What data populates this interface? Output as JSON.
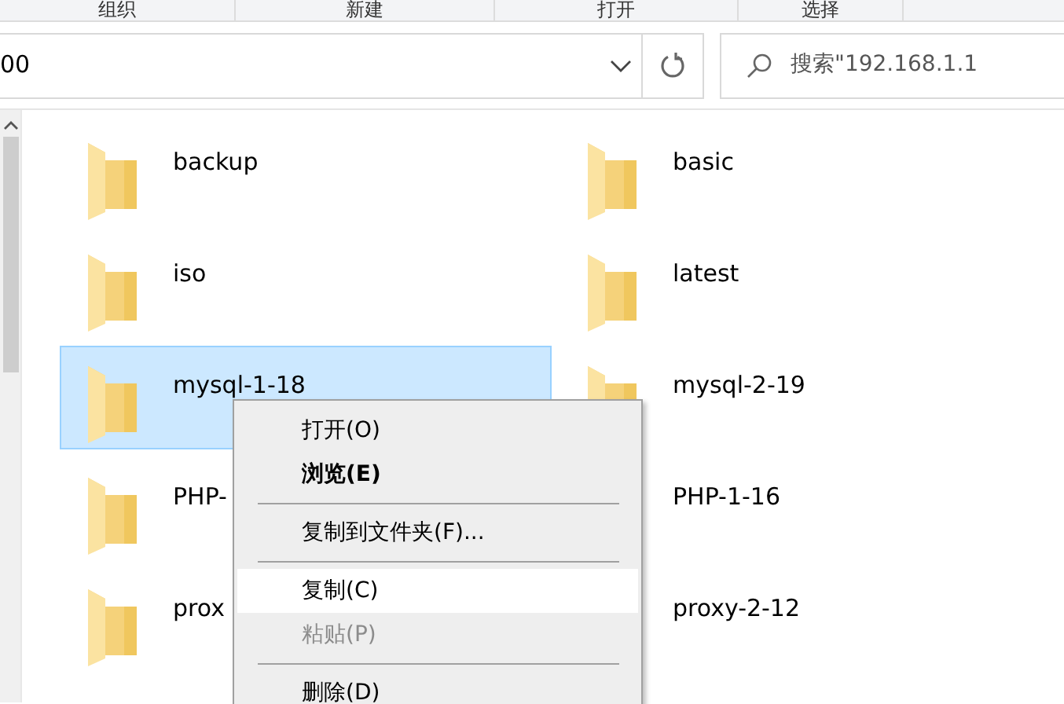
{
  "toolbar": {
    "groups": [
      "组织",
      "新建",
      "打开",
      "选择"
    ]
  },
  "address": {
    "value": "00"
  },
  "search": {
    "placeholder": "搜索\"192.168.1.1"
  },
  "folders": [
    {
      "name": "backup",
      "selected": false
    },
    {
      "name": "basic",
      "selected": false
    },
    {
      "name": "iso",
      "selected": false
    },
    {
      "name": "latest",
      "selected": false
    },
    {
      "name": "mysql-1-18",
      "selected": true
    },
    {
      "name": "mysql-2-19",
      "selected": false
    },
    {
      "name": "PHP-",
      "selected": false
    },
    {
      "name": "PHP-1-16",
      "selected": false
    },
    {
      "name": "prox",
      "selected": false
    },
    {
      "name": "proxy-2-12",
      "selected": false
    }
  ],
  "context_menu": {
    "items": [
      {
        "kind": "item",
        "label": "打开(O)",
        "bold": false,
        "highlighted": false,
        "disabled": false
      },
      {
        "kind": "item",
        "label": "浏览(E)",
        "bold": true,
        "highlighted": false,
        "disabled": false
      },
      {
        "kind": "separator"
      },
      {
        "kind": "item",
        "label": "复制到文件夹(F)...",
        "bold": false,
        "highlighted": false,
        "disabled": false
      },
      {
        "kind": "separator"
      },
      {
        "kind": "item",
        "label": "复制(C)",
        "bold": false,
        "highlighted": true,
        "disabled": false
      },
      {
        "kind": "item",
        "label": "粘贴(P)",
        "bold": false,
        "highlighted": false,
        "disabled": true
      },
      {
        "kind": "separator"
      },
      {
        "kind": "item",
        "label": "删除(D)",
        "bold": false,
        "highlighted": false,
        "disabled": false
      }
    ]
  }
}
